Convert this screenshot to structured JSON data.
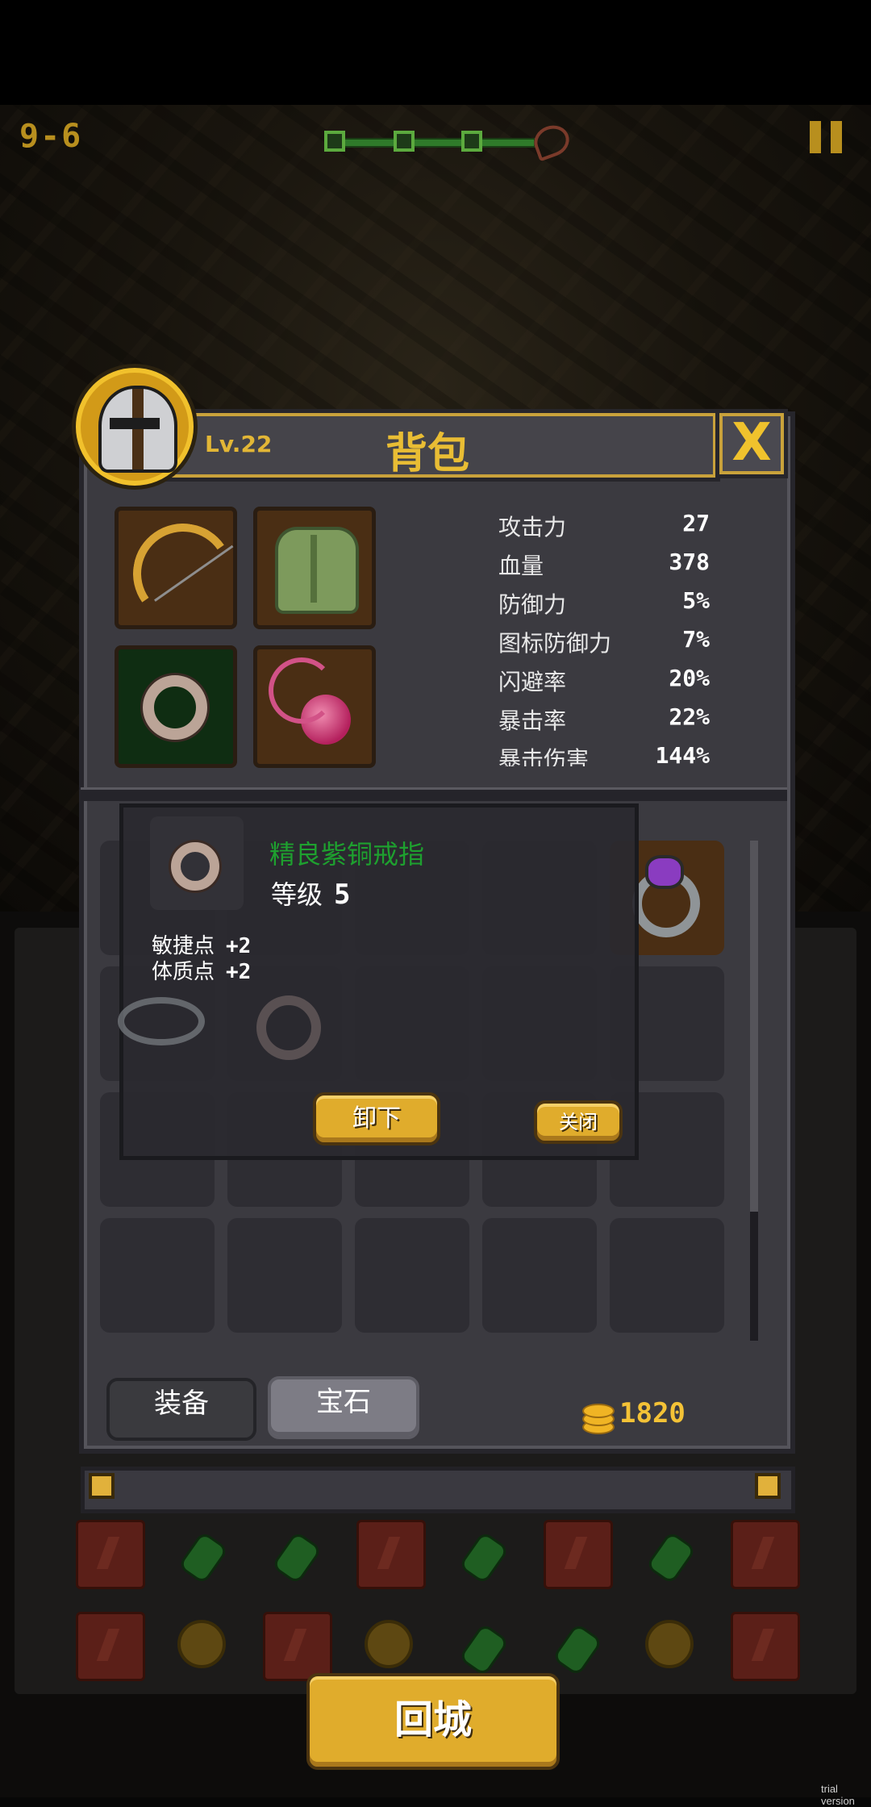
{
  "hud": {
    "stage": "9-6",
    "stage_progress_nodes": 3
  },
  "backpack": {
    "title": "背包",
    "level": "Lv.22",
    "close_label": "X"
  },
  "equipment": [
    {
      "name": "bow-item-icon"
    },
    {
      "name": "armor-item-icon"
    },
    {
      "name": "ring-item-icon"
    },
    {
      "name": "amulet-item-icon"
    }
  ],
  "stats": [
    {
      "label": "攻击力",
      "value": "27"
    },
    {
      "label": "血量",
      "value": "378"
    },
    {
      "label": "防御力",
      "value": "5%"
    },
    {
      "label": "图标防御力",
      "value": "7%"
    },
    {
      "label": "闪避率",
      "value": "20%"
    },
    {
      "label": "暴击率",
      "value": "22%"
    },
    {
      "label": "暴击伤害",
      "value": "144%"
    }
  ],
  "tooltip": {
    "name": "精良紫铜戒指",
    "level_label": "等级",
    "level_value": "5",
    "attributes": [
      {
        "label": "敏捷点",
        "value": "+2"
      },
      {
        "label": "体质点",
        "value": "+2"
      }
    ],
    "unequip_label": "卸下",
    "close_label": "关闭"
  },
  "tabs": {
    "equipment": "装备",
    "gems": "宝石"
  },
  "gold": "1820",
  "return_label": "回城",
  "watermark": "trial version",
  "colors": {
    "accent_gold": "#e0ac2c",
    "item_name_green": "#1ea02f",
    "panel": "#3b3a40"
  }
}
